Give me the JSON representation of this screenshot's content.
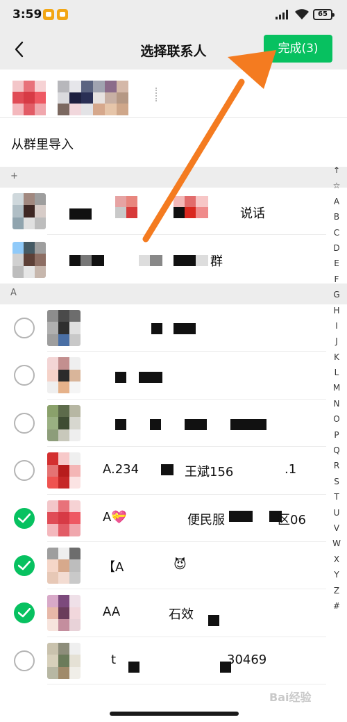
{
  "status_bar": {
    "time": "3:59",
    "battery": "65"
  },
  "nav": {
    "title": "选择联系人",
    "done_label": "完成(3)"
  },
  "group_import": {
    "label": "从群里导入"
  },
  "sections": {
    "plus": "+",
    "a": "A"
  },
  "groups": [
    {
      "name_tail": "说话"
    },
    {
      "name_tail": "群"
    }
  ],
  "contacts": [
    {
      "checked": false,
      "text_parts": []
    },
    {
      "checked": false,
      "text_parts": []
    },
    {
      "checked": false,
      "text_parts": []
    },
    {
      "checked": false,
      "text_parts": [
        "A.234",
        "王斌156",
        ".1"
      ]
    },
    {
      "checked": true,
      "text_parts": [
        "A💝",
        "便民服",
        "区06"
      ]
    },
    {
      "checked": true,
      "text_parts": [
        "【A",
        "😈"
      ]
    },
    {
      "checked": true,
      "text_parts": [
        "AA",
        "石效"
      ]
    },
    {
      "checked": false,
      "text_parts": [
        "t",
        "30469"
      ]
    }
  ],
  "index_letters": [
    "↑",
    "☆",
    "A",
    "B",
    "C",
    "D",
    "E",
    "F",
    "G",
    "H",
    "I",
    "J",
    "K",
    "L",
    "M",
    "N",
    "O",
    "P",
    "Q",
    "R",
    "S",
    "T",
    "U",
    "V",
    "W",
    "X",
    "Y",
    "Z",
    "#"
  ],
  "watermark": "Bai经验",
  "colors": {
    "accent": "#07c160",
    "arrow": "#f47b20",
    "background_gray": "#ededed"
  }
}
